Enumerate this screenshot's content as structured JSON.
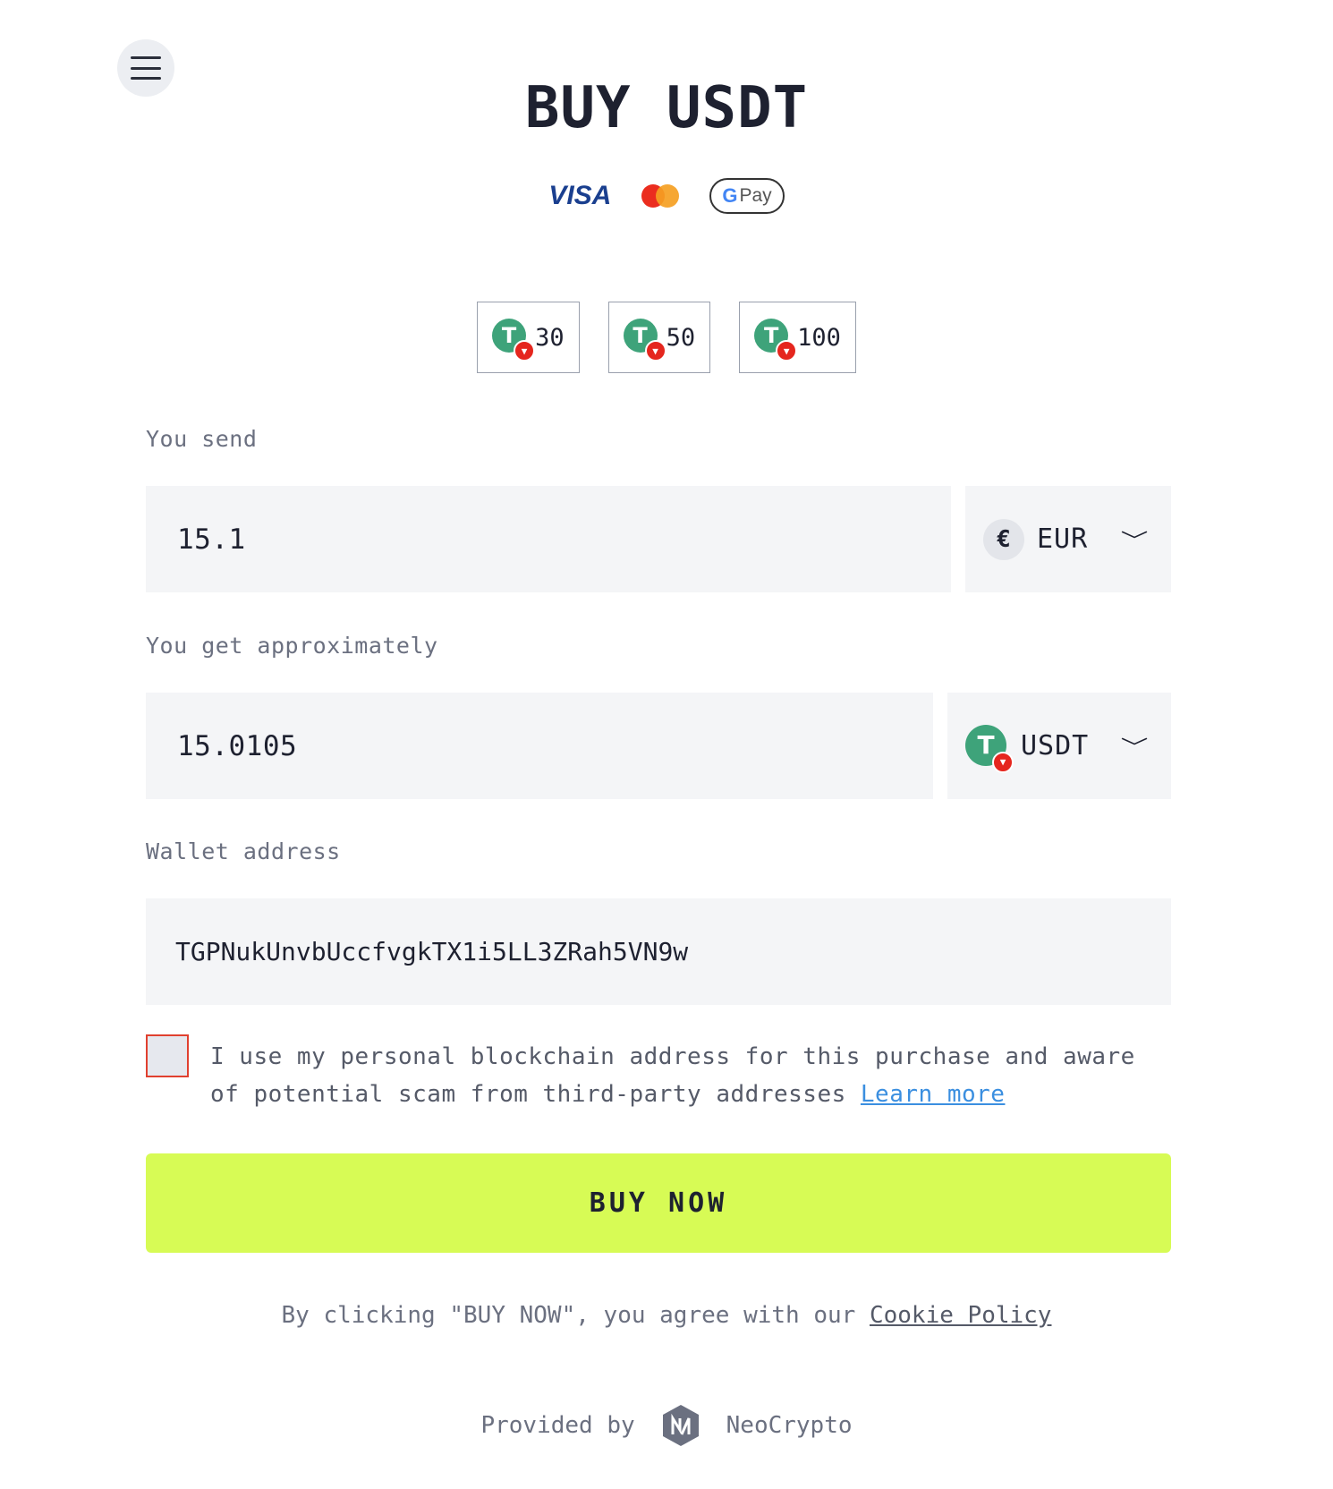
{
  "header": {
    "title": "BUY USDT"
  },
  "payment_methods": {
    "visa": "VISA",
    "mastercard": "mastercard",
    "gpay_g": "G",
    "gpay_label": "Pay"
  },
  "presets": [
    {
      "amount": "30"
    },
    {
      "amount": "50"
    },
    {
      "amount": "100"
    }
  ],
  "send": {
    "label": "You send",
    "value": "15.1",
    "currency_symbol": "€",
    "currency": "EUR"
  },
  "get": {
    "label": "You get approximately",
    "value": "15.0105",
    "currency": "USDT"
  },
  "wallet": {
    "label": "Wallet address",
    "value": "TGPNukUnvbUccfvgkTX1i5LL3ZRah5VN9w"
  },
  "consent": {
    "text": "I use my personal blockchain address for this purchase and aware of potential scam from third-party addresses",
    "link": "Learn more",
    "checked": false
  },
  "buy_button": "BUY NOW",
  "terms": {
    "text": "By clicking \"BUY NOW\", you agree with our",
    "link": "Cookie Policy"
  },
  "provider": {
    "prefix": "Provided by",
    "name": "NeoCrypto"
  },
  "icons": {
    "menu": "hamburger-icon",
    "tether": "tether-icon",
    "tron": "tron-icon",
    "chevron": "chevron-down-icon",
    "euro": "euro-icon",
    "logo": "neocrypto-logo"
  },
  "colors": {
    "accent_button": "#d7fb55",
    "tether_green": "#3ea37a",
    "tron_red": "#e5261e",
    "checkbox_border": "#e0402f",
    "link_blue": "#3b8fe0"
  }
}
